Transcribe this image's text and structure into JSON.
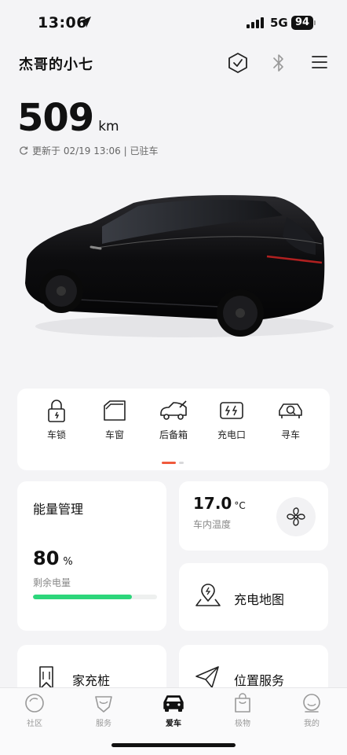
{
  "status_bar": {
    "time": "13:06",
    "network": "5G",
    "battery": "94"
  },
  "header": {
    "car_name": "杰哥的小七"
  },
  "range": {
    "value": "509",
    "unit": "km",
    "updated": "更新于 02/19 13:06 | 已驻车"
  },
  "controls": [
    {
      "label": "车锁",
      "icon": "lock-icon"
    },
    {
      "label": "车窗",
      "icon": "window-icon"
    },
    {
      "label": "后备箱",
      "icon": "trunk-icon"
    },
    {
      "label": "充电口",
      "icon": "charge-port-icon"
    },
    {
      "label": "寻车",
      "icon": "find-car-icon"
    }
  ],
  "energy": {
    "title": "能量管理",
    "percent": "80",
    "percent_unit": "%",
    "subtitle": "剩余电量",
    "level": 0.8,
    "bar_color": "#2dd67b"
  },
  "temperature": {
    "value": "17.0",
    "unit": "°C",
    "subtitle": "车内温度"
  },
  "tiles": {
    "charge_map": "充电地图",
    "home_charger": "家充桩",
    "location_service": "位置服务"
  },
  "tabbar": [
    {
      "label": "社区",
      "icon": "community-icon",
      "active": false
    },
    {
      "label": "服务",
      "icon": "service-icon",
      "active": false
    },
    {
      "label": "爱车",
      "icon": "car-icon",
      "active": true
    },
    {
      "label": "极物",
      "icon": "shop-bag-icon",
      "active": false
    },
    {
      "label": "我的",
      "icon": "profile-icon",
      "active": false
    }
  ],
  "colors": {
    "accent_green": "#2dd67b",
    "pager_active": "#f05a3c"
  }
}
